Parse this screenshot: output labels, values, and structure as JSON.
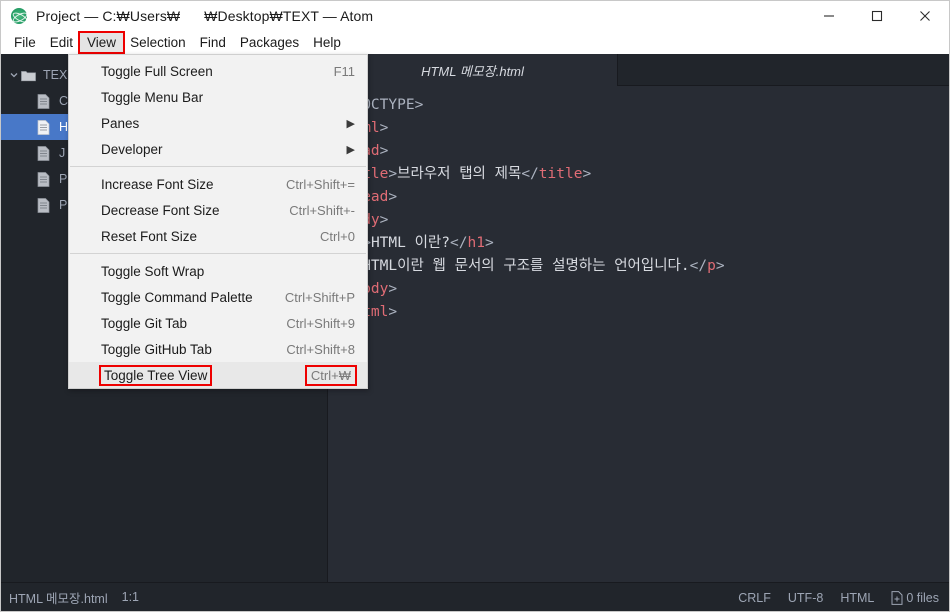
{
  "window": {
    "title": "Project — C:₩Users₩      ₩Desktop₩TEXT — Atom",
    "logo_icon": "atom-logo-icon",
    "controls": [
      {
        "name": "minimize-button",
        "glyph": "minimize-icon"
      },
      {
        "name": "maximize-button",
        "glyph": "maximize-icon"
      },
      {
        "name": "close-button",
        "glyph": "close-icon"
      }
    ]
  },
  "menubar": {
    "items": [
      {
        "label": "File",
        "active": false
      },
      {
        "label": "Edit",
        "active": false
      },
      {
        "label": "View",
        "active": true
      },
      {
        "label": "Selection",
        "active": false
      },
      {
        "label": "Find",
        "active": false
      },
      {
        "label": "Packages",
        "active": false
      },
      {
        "label": "Help",
        "active": false
      }
    ]
  },
  "view_menu": {
    "items": [
      {
        "label": "Toggle Full Screen",
        "accel": "F11",
        "submenu": false,
        "highlighted": false,
        "annotated_label": false,
        "annotated_accel": false
      },
      {
        "label": "Toggle Menu Bar",
        "accel": "",
        "submenu": false,
        "highlighted": false,
        "annotated_label": false,
        "annotated_accel": false
      },
      {
        "label": "Panes",
        "accel": "",
        "submenu": true,
        "highlighted": false,
        "annotated_label": false,
        "annotated_accel": false
      },
      {
        "label": "Developer",
        "accel": "",
        "submenu": true,
        "highlighted": false,
        "annotated_label": false,
        "annotated_accel": false
      },
      {
        "separator": true
      },
      {
        "label": "Increase Font Size",
        "accel": "Ctrl+Shift+=",
        "submenu": false,
        "highlighted": false,
        "annotated_label": false,
        "annotated_accel": false
      },
      {
        "label": "Decrease Font Size",
        "accel": "Ctrl+Shift+-",
        "submenu": false,
        "highlighted": false,
        "annotated_label": false,
        "annotated_accel": false
      },
      {
        "label": "Reset Font Size",
        "accel": "Ctrl+0",
        "submenu": false,
        "highlighted": false,
        "annotated_label": false,
        "annotated_accel": false
      },
      {
        "separator": true
      },
      {
        "label": "Toggle Soft Wrap",
        "accel": "",
        "submenu": false,
        "highlighted": false,
        "annotated_label": false,
        "annotated_accel": false
      },
      {
        "label": "Toggle Command Palette",
        "accel": "Ctrl+Shift+P",
        "submenu": false,
        "highlighted": false,
        "annotated_label": false,
        "annotated_accel": false
      },
      {
        "label": "Toggle Git Tab",
        "accel": "Ctrl+Shift+9",
        "submenu": false,
        "highlighted": false,
        "annotated_label": false,
        "annotated_accel": false
      },
      {
        "label": "Toggle GitHub Tab",
        "accel": "Ctrl+Shift+8",
        "submenu": false,
        "highlighted": false,
        "annotated_label": false,
        "annotated_accel": false
      },
      {
        "label": "Toggle Tree View",
        "accel": "Ctrl+₩",
        "submenu": false,
        "highlighted": true,
        "annotated_label": true,
        "annotated_accel": true
      }
    ]
  },
  "treeview": {
    "root": {
      "label": "TEX",
      "chevron": "chevron-down-icon",
      "icon": "folder-icon"
    },
    "files": [
      {
        "label": "C",
        "icon": "file-icon",
        "selected": false
      },
      {
        "label": "H",
        "icon": "file-icon",
        "selected": true
      },
      {
        "label": "J",
        "icon": "file-icon",
        "selected": false
      },
      {
        "label": "P",
        "icon": "file-icon",
        "selected": false
      },
      {
        "label": "P",
        "icon": "file-icon",
        "selected": false
      }
    ]
  },
  "tabs": [
    {
      "label": "HTML 메모장.html",
      "active": true
    }
  ],
  "editor": {
    "lines": [
      [
        {
          "t": "punct",
          "s": "<!DOCTYPE>"
        }
      ],
      [
        {
          "t": "punct",
          "s": "<"
        },
        {
          "t": "tag",
          "s": "html"
        },
        {
          "t": "punct",
          "s": ">"
        }
      ],
      [
        {
          "t": "punct",
          "s": "<"
        },
        {
          "t": "tag",
          "s": "head"
        },
        {
          "t": "punct",
          "s": ">"
        }
      ],
      [
        {
          "t": "punct",
          "s": "<"
        },
        {
          "t": "tag",
          "s": "title"
        },
        {
          "t": "punct",
          "s": ">"
        },
        {
          "t": "text",
          "s": "브라우저 탭의 제목"
        },
        {
          "t": "punct",
          "s": "</"
        },
        {
          "t": "tag",
          "s": "title"
        },
        {
          "t": "punct",
          "s": ">"
        }
      ],
      [
        {
          "t": "punct",
          "s": "</"
        },
        {
          "t": "tag",
          "s": "head"
        },
        {
          "t": "punct",
          "s": ">"
        }
      ],
      [
        {
          "t": "punct",
          "s": "<"
        },
        {
          "t": "tag",
          "s": "body"
        },
        {
          "t": "punct",
          "s": ">"
        }
      ],
      [
        {
          "t": "punct",
          "s": "<"
        },
        {
          "t": "tag",
          "s": "h1"
        },
        {
          "t": "punct",
          "s": ">"
        },
        {
          "t": "text",
          "s": "HTML 이란?"
        },
        {
          "t": "punct",
          "s": "</"
        },
        {
          "t": "tag",
          "s": "h1"
        },
        {
          "t": "punct",
          "s": ">"
        }
      ],
      [
        {
          "t": "punct",
          "s": "<"
        },
        {
          "t": "tag",
          "s": "p"
        },
        {
          "t": "punct",
          "s": ">"
        },
        {
          "t": "text",
          "s": "HTML이란 웹 문서의 구조를 설명하는 언어입니다."
        },
        {
          "t": "punct",
          "s": "</"
        },
        {
          "t": "tag",
          "s": "p"
        },
        {
          "t": "punct",
          "s": ">"
        }
      ],
      [
        {
          "t": "punct",
          "s": "</"
        },
        {
          "t": "tag",
          "s": "body"
        },
        {
          "t": "punct",
          "s": ">"
        }
      ],
      [
        {
          "t": "punct",
          "s": "</"
        },
        {
          "t": "tag",
          "s": "html"
        },
        {
          "t": "punct",
          "s": ">"
        }
      ]
    ]
  },
  "statusbar": {
    "filename": "HTML 메모장.html",
    "cursor": "1:1",
    "line_ending": "CRLF",
    "encoding": "UTF-8",
    "grammar": "HTML",
    "files_count": "0 files",
    "files_icon": "file-add-icon"
  },
  "colors": {
    "accent_selection": "#4878c8",
    "annotation_red": "#ee0000",
    "editor_bg": "#282c34",
    "chrome_bg": "#21252b",
    "tag_color": "#e06c75"
  }
}
